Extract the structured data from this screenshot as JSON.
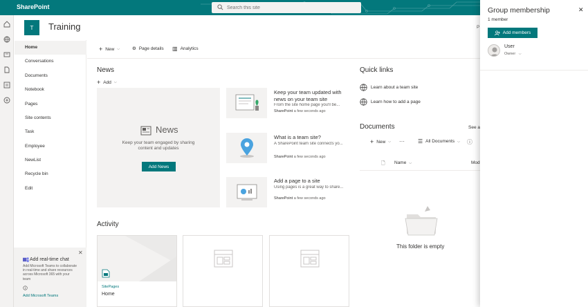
{
  "suite": {
    "brand": "SharePoint",
    "search_placeholder": "Search this site"
  },
  "site": {
    "logo_letter": "T",
    "title": "Training"
  },
  "nav": {
    "items": [
      {
        "label": "Home",
        "active": true
      },
      {
        "label": "Conversations"
      },
      {
        "label": "Documents"
      },
      {
        "label": "Notebook"
      },
      {
        "label": "Pages"
      },
      {
        "label": "Site contents"
      },
      {
        "label": "Task"
      },
      {
        "label": "Employee"
      },
      {
        "label": "NewList"
      },
      {
        "label": "Recycle bin"
      },
      {
        "label": "Edit"
      }
    ]
  },
  "command_bar": {
    "new_label": "New",
    "page_details_label": "Page details",
    "analytics_label": "Analytics"
  },
  "news": {
    "title": "News",
    "add_label": "Add",
    "feature_title": "News",
    "feature_subtitle": "Keep your team engaged by sharing content and updates",
    "add_news_button": "Add News",
    "items": [
      {
        "title": "Keep your team updated with news on your team site",
        "description": "From the site home page you'll be...",
        "author": "SharePoint",
        "time": "a few seconds ago"
      },
      {
        "title": "What is a team site?",
        "description": "A SharePoint team site connects yo...",
        "author": "SharePoint",
        "time": "a few seconds ago"
      },
      {
        "title": "Add a page to a site",
        "description": "Using pages is a great way to share...",
        "author": "SharePoint",
        "time": "a few seconds ago"
      }
    ]
  },
  "quick_links": {
    "title": "Quick links",
    "items": [
      {
        "label": "Learn about a team site"
      },
      {
        "label": "Learn how to add a page"
      }
    ]
  },
  "documents": {
    "title": "Documents",
    "see_all": "See all",
    "new_label": "New",
    "view_label": "All Documents",
    "col_name": "Name",
    "col_modified": "Mod",
    "empty_text": "This folder is empty"
  },
  "activity": {
    "title": "Activity",
    "cards": [
      {
        "site": "SitePages",
        "name": "Home"
      },
      {
        "site": "",
        "name": ""
      },
      {
        "site": "",
        "name": ""
      }
    ]
  },
  "promo": {
    "title": "Add real-time chat",
    "body": "Add Microsoft Teams to collaborate in real-time and share resources across Microsoft 365 with your team",
    "link": "Add Microsoft Teams"
  },
  "panel": {
    "title": "Group membership",
    "member_count": "1 member",
    "add_members_label": "Add members",
    "behind_text": "P",
    "members": [
      {
        "name": "User",
        "role": "Owner"
      }
    ]
  },
  "colors": {
    "brand": "#03787c",
    "text": "#323130",
    "muted": "#605e5c",
    "panel_bg": "#ffffff",
    "neutral_bg": "#f3f2f1"
  }
}
